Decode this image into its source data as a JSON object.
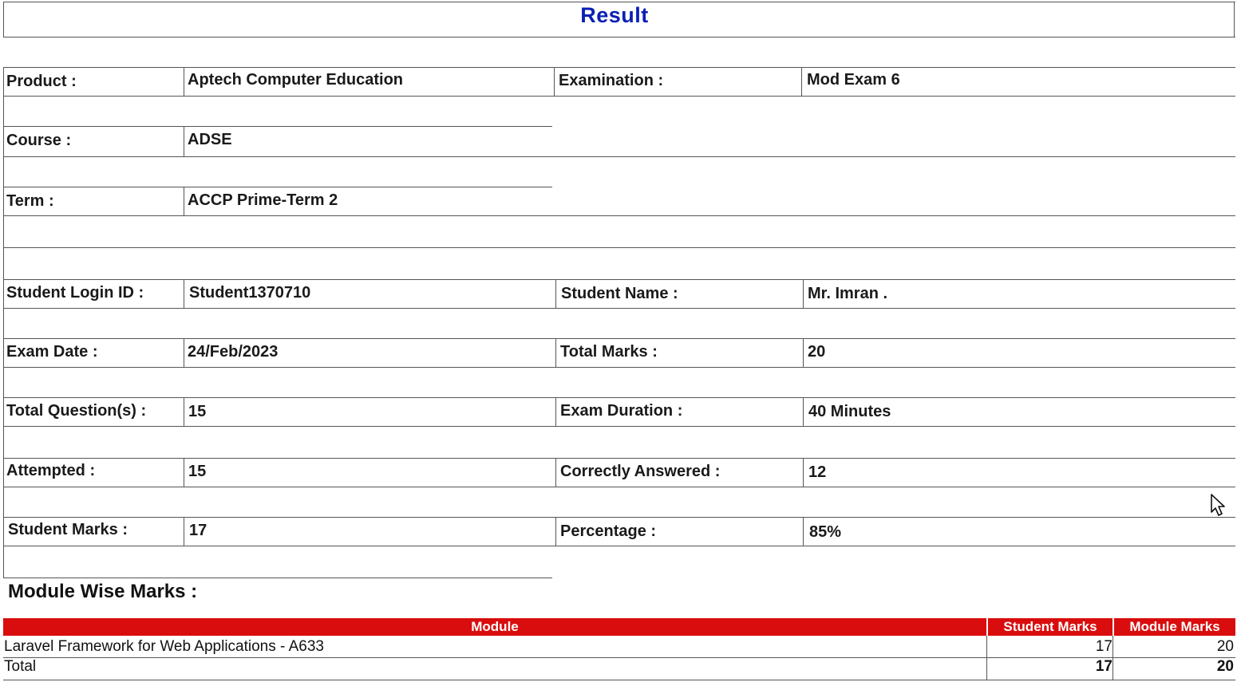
{
  "page": {
    "title": "Result"
  },
  "details": {
    "product_label": "Product :",
    "product_value": "Aptech Computer Education",
    "examination_label": "Examination :",
    "examination_value": "Mod Exam 6",
    "course_label": "Course :",
    "course_value": "ADSE",
    "term_label": "Term :",
    "term_value": "ACCP Prime-Term 2"
  },
  "student": {
    "login_label": "Student Login ID :",
    "login_value": "Student1370710",
    "name_label": "Student Name :",
    "name_value": "Mr. Imran .",
    "exam_date_label": "Exam Date :",
    "exam_date_value": "24/Feb/2023",
    "total_marks_label": "Total Marks :",
    "total_marks_value": "20",
    "total_questions_label": "Total Question(s) :",
    "total_questions_value": "15",
    "duration_label": "Exam Duration :",
    "duration_value": "40 Minutes",
    "attempted_label": "Attempted :",
    "attempted_value": "15",
    "correct_label": "Correctly Answered :",
    "correct_value": "12",
    "student_marks_label": "Student Marks :",
    "student_marks_value": "17",
    "percentage_label": "Percentage :",
    "percentage_value": "85%"
  },
  "modules": {
    "heading": "Module Wise Marks :",
    "columns": [
      "Module",
      "Student Marks",
      "Module Marks"
    ],
    "rows": [
      {
        "module": "Laravel Framework for Web Applications - A633",
        "student_marks": "17",
        "module_marks": "20"
      }
    ],
    "total": {
      "label": "Total",
      "student_marks": "17",
      "module_marks": "20"
    }
  },
  "colors": {
    "title": "#0a1fb5",
    "table_header": "#d90d0d"
  }
}
